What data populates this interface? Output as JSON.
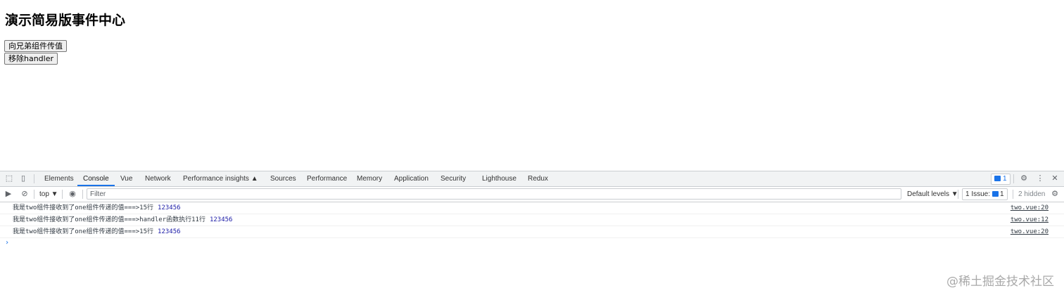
{
  "page": {
    "heading": "演示简易版事件中心",
    "buttons": [
      {
        "label": "向兄弟组件传值"
      },
      {
        "label": "移除handler"
      }
    ]
  },
  "devtools": {
    "tabs": [
      "Elements",
      "Console",
      "Vue",
      "Network",
      "Performance insights ▲",
      "Sources",
      "Performance",
      "Memory",
      "Application",
      "Security",
      "Lighthouse",
      "Redux"
    ],
    "active_tab": "Console",
    "issues_count": "1",
    "console_toolbar": {
      "context": "top ▼",
      "filter_placeholder": "Filter",
      "levels": "Default levels ▼",
      "issues": "1 Issue:",
      "issues_count": "1",
      "hidden": "2 hidden"
    },
    "messages": [
      {
        "text": "我是two组件接收到了one组件传递的值===>15行",
        "value": "123456",
        "source": "two.vue:20"
      },
      {
        "text": "我是two组件接收到了one组件传递的值===>handler函数执行11行",
        "value": "123456",
        "source": "two.vue:12"
      },
      {
        "text": "我是two组件接收到了one组件传递的值===>15行",
        "value": "123456",
        "source": "two.vue:20"
      }
    ],
    "prompt": "›"
  },
  "watermark": "@稀土掘金技术社区"
}
